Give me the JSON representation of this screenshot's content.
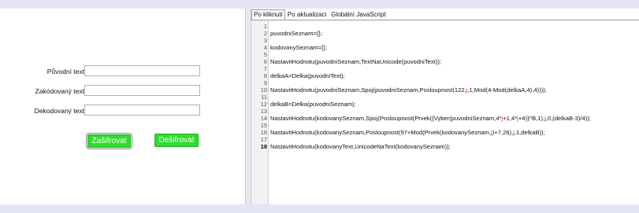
{
  "form": {
    "original_label": "Původní text",
    "encoded_label": "Zakódovaný text",
    "decoded_label": "Dekodovaný text",
    "original_value": "",
    "encoded_value": "",
    "decoded_value": "",
    "encrypt_button": "Zašifrovat",
    "decrypt_button": "Dešifrovat"
  },
  "tabs": [
    "Po kliknutí",
    "Po aktualizaci",
    "Globální JavaScript"
  ],
  "active_tab": 0,
  "code_lines": [
    {
      "num": "1",
      "parts": [
        {
          "t": ""
        }
      ]
    },
    {
      "num": "2",
      "parts": [
        {
          "t": "puvodniSeznam={};"
        }
      ]
    },
    {
      "num": "3",
      "parts": [
        {
          "t": ""
        }
      ]
    },
    {
      "num": "4",
      "parts": [
        {
          "t": "kodovanySeznam={};"
        }
      ]
    },
    {
      "num": "5",
      "parts": [
        {
          "t": ""
        }
      ]
    },
    {
      "num": "6",
      "parts": [
        {
          "t": "NastavitHodnotu(puvodniSeznam,TextNaUnicode(puvodniText));"
        }
      ]
    },
    {
      "num": "7",
      "parts": [
        {
          "t": ""
        }
      ]
    },
    {
      "num": "8",
      "parts": [
        {
          "t": "delkaA=Delka(puvodniText);"
        }
      ]
    },
    {
      "num": "9",
      "parts": [
        {
          "t": ""
        }
      ]
    },
    {
      "num": "10",
      "parts": [
        {
          "t": "NastavitHodnotu(puvodniSeznam,Spoj(puvodniSeznam,Posloupnost(122,"
        },
        {
          "t": "j",
          "v": true
        },
        {
          "t": ",1,Mod(4-Mod(delkaA,4),4))));"
        }
      ]
    },
    {
      "num": "11",
      "parts": [
        {
          "t": ""
        }
      ]
    },
    {
      "num": "12",
      "parts": [
        {
          "t": "delkaB=Delka(puvodniSeznam);"
        }
      ]
    },
    {
      "num": "13",
      "parts": [
        {
          "t": ""
        }
      ]
    },
    {
      "num": "14",
      "parts": [
        {
          "t": "NastavitHodnotu(kodovanySeznam,Spoj(Posloupnost(Prvek({Vyber(puvodniSeznam,4*"
        },
        {
          "t": "j",
          "v": true
        },
        {
          "t": "+1,4*"
        },
        {
          "t": "j",
          "v": true
        },
        {
          "t": "+4)}^B,1),"
        },
        {
          "t": "j",
          "v": true
        },
        {
          "t": ",0,(delkaB-3)/4));"
        }
      ]
    },
    {
      "num": "15",
      "parts": [
        {
          "t": ""
        }
      ]
    },
    {
      "num": "16",
      "parts": [
        {
          "t": "NastavitHodnotu(kodovanySeznam,Posloupnost(97+Mod(Prvek(kodovanySeznam,"
        },
        {
          "t": "j",
          "v": true
        },
        {
          "t": ")+7,26),"
        },
        {
          "t": "j",
          "v": true
        },
        {
          "t": ",1,delkaB));"
        }
      ]
    },
    {
      "num": "17",
      "parts": [
        {
          "t": ""
        }
      ]
    },
    {
      "num": "18",
      "parts": [
        {
          "t": "NastavitHodnotu(kodovanyText,UnicodeNaText(kodovanySeznam));"
        }
      ],
      "bold": true
    }
  ]
}
